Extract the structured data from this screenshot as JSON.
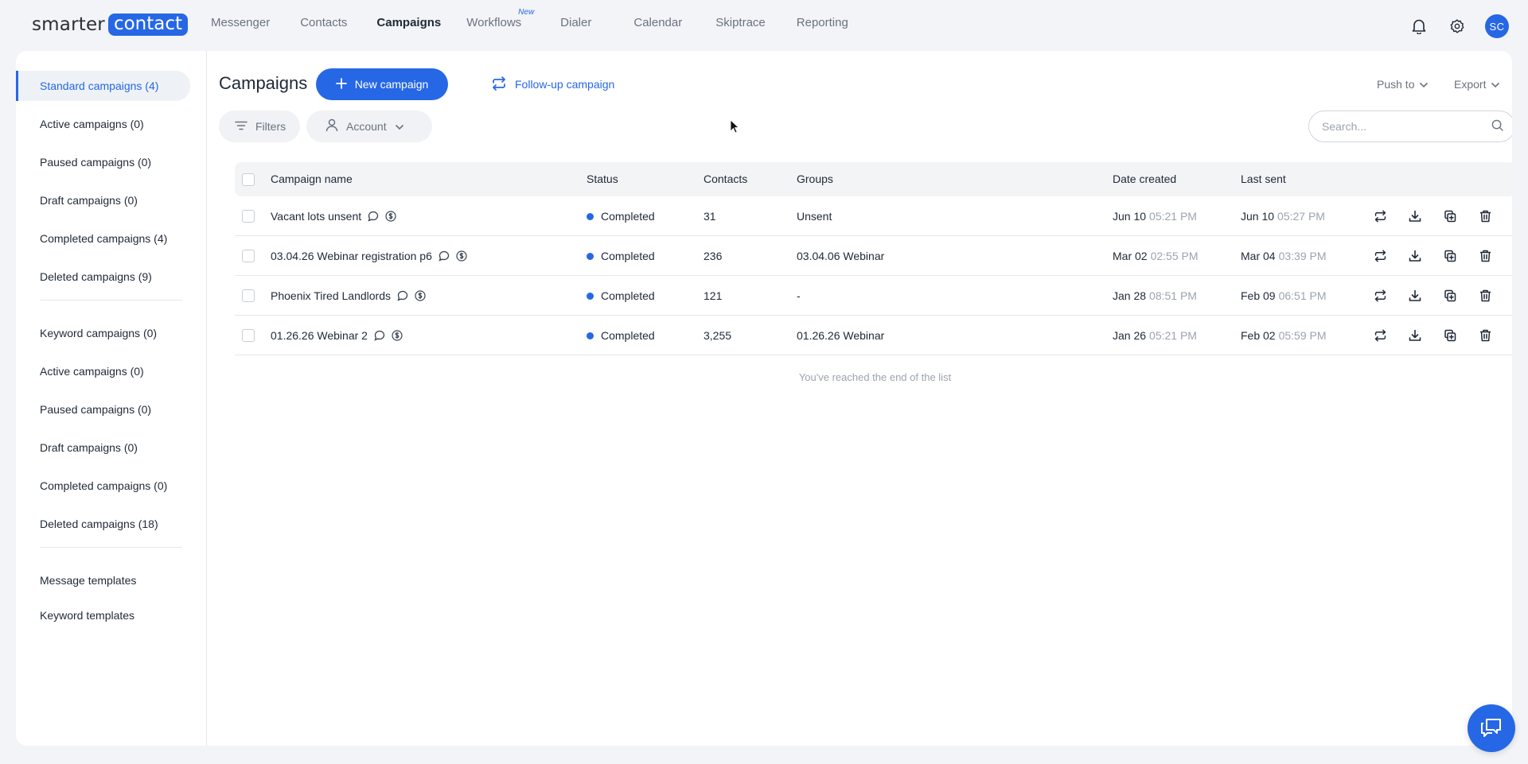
{
  "brand": {
    "part1": "smarter",
    "part2": "contact"
  },
  "nav": [
    {
      "label": "Messenger",
      "active": false,
      "badge": ""
    },
    {
      "label": "Contacts",
      "active": false,
      "badge": ""
    },
    {
      "label": "Campaigns",
      "active": true,
      "badge": ""
    },
    {
      "label": "Workflows",
      "active": false,
      "badge": "New"
    },
    {
      "label": "Dialer",
      "active": false,
      "badge": ""
    },
    {
      "label": "Calendar",
      "active": false,
      "badge": ""
    },
    {
      "label": "Skiptrace",
      "active": false,
      "badge": ""
    },
    {
      "label": "Reporting",
      "active": false,
      "badge": ""
    }
  ],
  "user": {
    "initials": "SC"
  },
  "sidebar": {
    "standard": [
      {
        "label": "Standard campaigns (4)",
        "active": true
      },
      {
        "label": "Active campaigns (0)"
      },
      {
        "label": "Paused campaigns (0)"
      },
      {
        "label": "Draft campaigns (0)"
      },
      {
        "label": "Completed campaigns (4)"
      },
      {
        "label": "Deleted campaigns (9)"
      }
    ],
    "keyword": [
      {
        "label": "Keyword campaigns (0)"
      },
      {
        "label": "Active campaigns (0)"
      },
      {
        "label": "Paused campaigns (0)"
      },
      {
        "label": "Draft campaigns (0)"
      },
      {
        "label": "Completed campaigns (0)"
      },
      {
        "label": "Deleted campaigns (18)"
      }
    ],
    "templates": [
      {
        "label": "Message templates"
      },
      {
        "label": "Keyword templates"
      }
    ]
  },
  "header": {
    "title": "Campaigns",
    "new_campaign": "New campaign",
    "follow_up": "Follow-up campaign",
    "push_to": "Push to",
    "export": "Export"
  },
  "filters": {
    "filters_label": "Filters",
    "account_label": "Account",
    "search_placeholder": "Search..."
  },
  "table": {
    "columns": {
      "name": "Campaign name",
      "status": "Status",
      "contacts": "Contacts",
      "groups": "Groups",
      "created": "Date created",
      "last_sent": "Last sent"
    },
    "rows": [
      {
        "name": "Vacant lots unsent",
        "status": "Completed",
        "contacts": "31",
        "groups": "Unsent",
        "created_date": "Jun 10",
        "created_time": "05:21 PM",
        "sent_date": "Jun 10",
        "sent_time": "05:27 PM"
      },
      {
        "name": "03.04.26 Webinar registration p6",
        "status": "Completed",
        "contacts": "236",
        "groups": "03.04.06 Webinar",
        "created_date": "Mar 02",
        "created_time": "02:55 PM",
        "sent_date": "Mar 04",
        "sent_time": "03:39 PM"
      },
      {
        "name": "Phoenix Tired Landlords",
        "status": "Completed",
        "contacts": "121",
        "groups": "-",
        "created_date": "Jan 28",
        "created_time": "08:51 PM",
        "sent_date": "Feb 09",
        "sent_time": "06:51 PM"
      },
      {
        "name": "01.26.26 Webinar 2",
        "status": "Completed",
        "contacts": "3,255",
        "groups": "01.26.26 Webinar",
        "created_date": "Jan 26",
        "created_time": "05:21 PM",
        "sent_date": "Feb 02",
        "sent_time": "05:59 PM"
      }
    ],
    "end_message": "You've reached the end of the list"
  },
  "colors": {
    "accent": "#2667e6",
    "status_completed": "#2667e6"
  },
  "icons": [
    "bell-icon",
    "gear-icon",
    "plus-icon",
    "repeat-icon",
    "chevron-down-icon",
    "filter-icon",
    "user-icon",
    "search-icon",
    "chat-bubble-icon",
    "dollar-icon",
    "download-icon",
    "copy-icon",
    "trash-icon",
    "chat-support-icon"
  ]
}
